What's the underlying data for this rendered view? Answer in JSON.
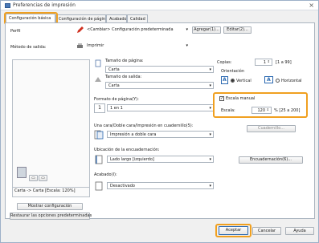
{
  "window": {
    "title": "Preferencias de impresión",
    "close": "×"
  },
  "tabs": [
    "Configuración básica",
    "Configuración de página",
    "Acabado",
    "Calidad"
  ],
  "profile": {
    "label": "Perfil",
    "value": "<Cambiar> Configuración predeterminada",
    "add": "Agregar(1)...",
    "edit": "Editar(2)..."
  },
  "output": {
    "label": "Método de salida:",
    "value": "Imprimir"
  },
  "preview": {
    "caption": "Carta -> Carta [Escala: 120%]"
  },
  "page_size": {
    "label": "Tamaño de página:",
    "value": "Carta"
  },
  "output_size": {
    "label": "Tamaño de salida:",
    "value": "Carta"
  },
  "copies": {
    "label": "Copias:",
    "value": "1",
    "range": "[1 a 99]"
  },
  "orientation": {
    "label": "Orientación",
    "vertical": "Vertical",
    "horizontal": "Horizontal",
    "selected": "vertical"
  },
  "page_format": {
    "label": "Formato de página(Y):",
    "value": "1 en 1"
  },
  "manual_scale": {
    "label": "Escala manual",
    "checked": true
  },
  "scale": {
    "label": "Escala:",
    "value": "120",
    "range": "% [25 a 200]"
  },
  "duplex": {
    "label": "Una cara/Doble cara/Impresión en cuadernillo(5):",
    "value": "Impresión a doble cara",
    "booklet_button": "Cuadernillo..."
  },
  "binding": {
    "label": "Ubicación de la encuadernación:",
    "value": "Lado largo [izquierdo]",
    "button": "Encuadernación(6)..."
  },
  "finishing": {
    "label": "Acabado(I):",
    "value": "Desactivado"
  },
  "left_buttons": {
    "show": "Mostrar configuración",
    "restore": "Restaurar las opciones predeterminadas"
  },
  "footer": {
    "ok": "Aceptar",
    "cancel": "Cancelar",
    "help": "Ayuda"
  },
  "colors": {
    "highlight": "#f0a020",
    "accent": "#2a68b0"
  }
}
